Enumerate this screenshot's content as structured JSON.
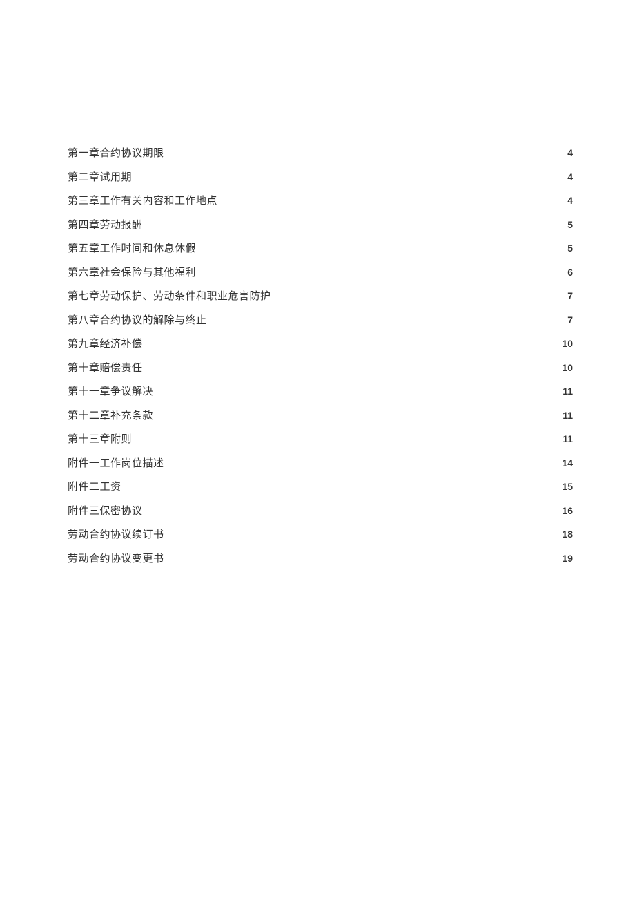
{
  "toc": [
    {
      "title": "第一章合约协议期限",
      "page": "4"
    },
    {
      "title": "第二章试用期",
      "page": "4"
    },
    {
      "title": "第三章工作有关内容和工作地点",
      "page": "4"
    },
    {
      "title": "第四章劳动报酬",
      "page": "5"
    },
    {
      "title": "第五章工作时间和休息休假",
      "page": "5"
    },
    {
      "title": "第六章社会保险与其他福利",
      "page": "6"
    },
    {
      "title": "第七章劳动保护、劳动条件和职业危害防护",
      "page": "7"
    },
    {
      "title": "第八章合约协议的解除与终止",
      "page": "7"
    },
    {
      "title": "第九章经济补偿",
      "page": "10"
    },
    {
      "title": "第十章赔偿责任",
      "page": "10"
    },
    {
      "title": "第十一章争议解决",
      "page": "11"
    },
    {
      "title": "第十二章补充条款",
      "page": "11"
    },
    {
      "title": "第十三章附则",
      "page": "11"
    },
    {
      "title": "附件一工作岗位描述",
      "page": "14"
    },
    {
      "title": "附件二工资",
      "page": "15"
    },
    {
      "title": "附件三保密协议",
      "page": "16"
    },
    {
      "title": "劳动合约协议续订书",
      "page": "18"
    },
    {
      "title": "劳动合约协议变更书",
      "page": "19"
    }
  ]
}
